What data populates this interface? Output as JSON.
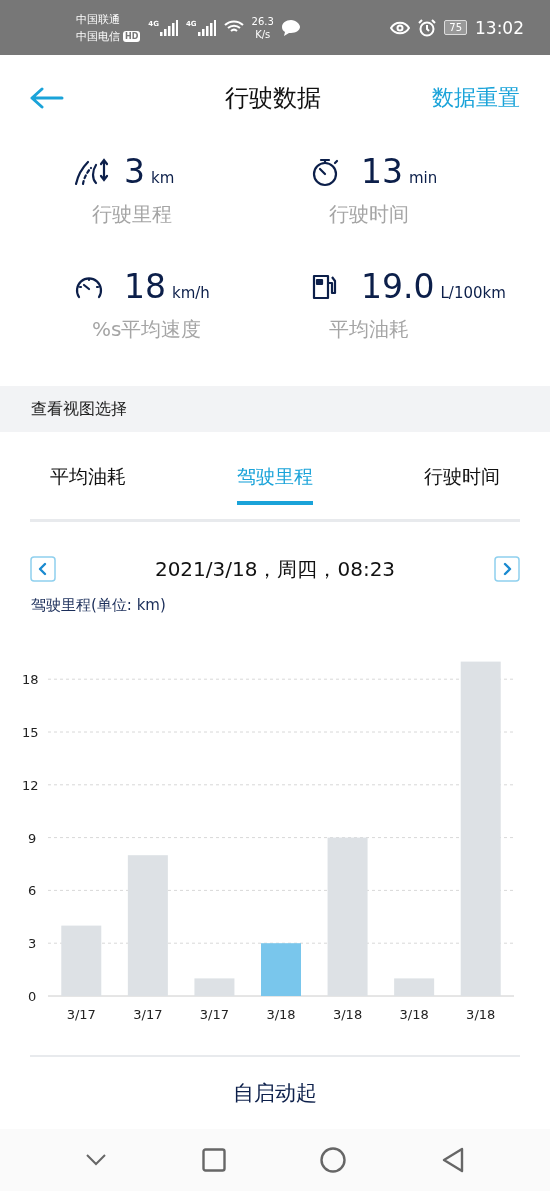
{
  "status_bar": {
    "carriers": [
      "中国联通",
      "中国电信"
    ],
    "hd": "HD",
    "networks": [
      "4G",
      "4G"
    ],
    "speed": "26.3",
    "speed_unit": "K/s",
    "battery": "75",
    "time": "13:02"
  },
  "header": {
    "title": "行驶数据",
    "action": "数据重置"
  },
  "stats": [
    {
      "kind": "distance",
      "value": "3",
      "unit": "km",
      "label": "行驶里程"
    },
    {
      "kind": "time",
      "value": "13",
      "unit": "min",
      "label": "行驶时间"
    },
    {
      "kind": "speed",
      "value": "18",
      "unit": "km/h",
      "label": "%s平均速度"
    },
    {
      "kind": "fuel",
      "value": "19.0",
      "unit": "L/100km",
      "label": "平均油耗"
    }
  ],
  "section_title": "查看视图选择",
  "tabs": [
    {
      "label": "平均油耗",
      "selected": false
    },
    {
      "label": "驾驶里程",
      "selected": true
    },
    {
      "label": "行驶时间",
      "selected": false
    }
  ],
  "date": "2021/3/18，周四，08:23",
  "chart": {
    "label": "驾驶里程(单位: km)",
    "chart_data": {
      "type": "bar",
      "categories": [
        "3/17",
        "3/17",
        "3/17",
        "3/18",
        "3/18",
        "3/18",
        "3/18"
      ],
      "series": [
        {
          "color": "#dde1e5",
          "values": [
            4,
            8,
            1,
            null,
            9,
            1,
            19
          ]
        },
        {
          "color": "#79c6ec",
          "values": [
            null,
            null,
            null,
            3,
            null,
            null,
            null
          ]
        }
      ],
      "stacked": true,
      "grid": true,
      "ylim": [
        0,
        19
      ],
      "yticks": [
        0,
        3,
        6,
        9,
        12,
        15,
        18
      ]
    }
  },
  "footer_title": "自启动起"
}
